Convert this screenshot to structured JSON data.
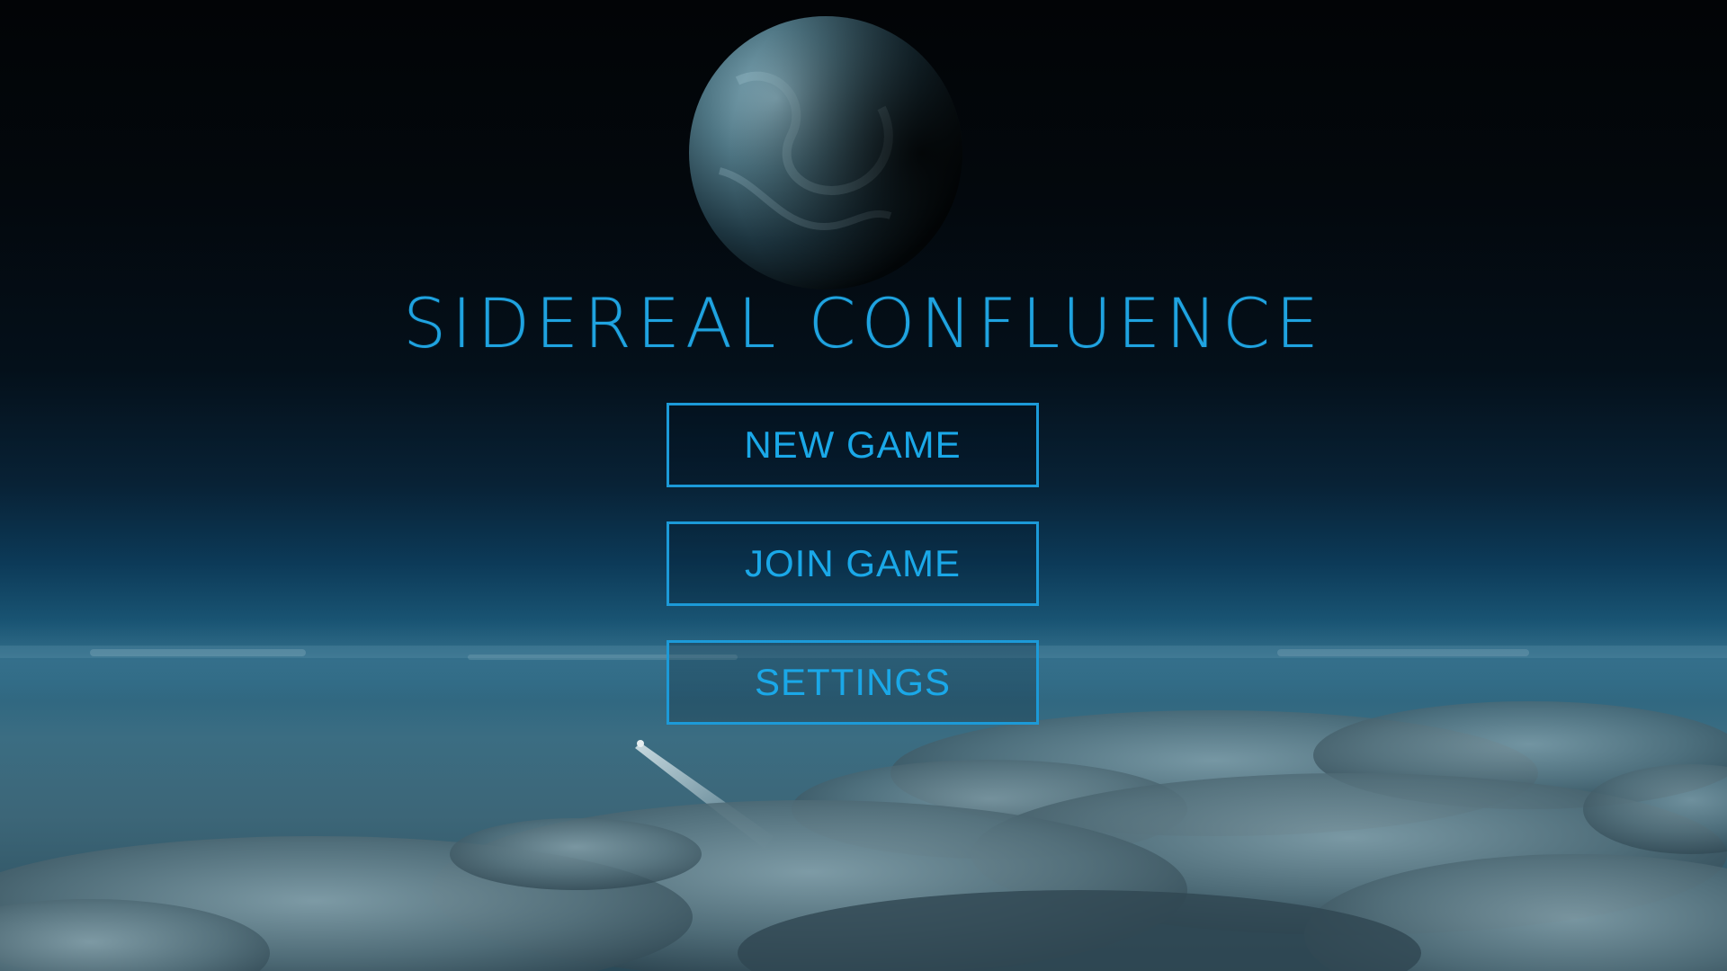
{
  "game": {
    "title": "SIDEREAL CONFLUENCE"
  },
  "menu": {
    "items": [
      {
        "label": "NEW GAME"
      },
      {
        "label": "JOIN GAME"
      },
      {
        "label": "SETTINGS"
      }
    ]
  },
  "colors": {
    "accent": "#1fa3e0",
    "sky_top": "#020406",
    "horizon": "#195473",
    "clouds": "#4a6e7e"
  }
}
